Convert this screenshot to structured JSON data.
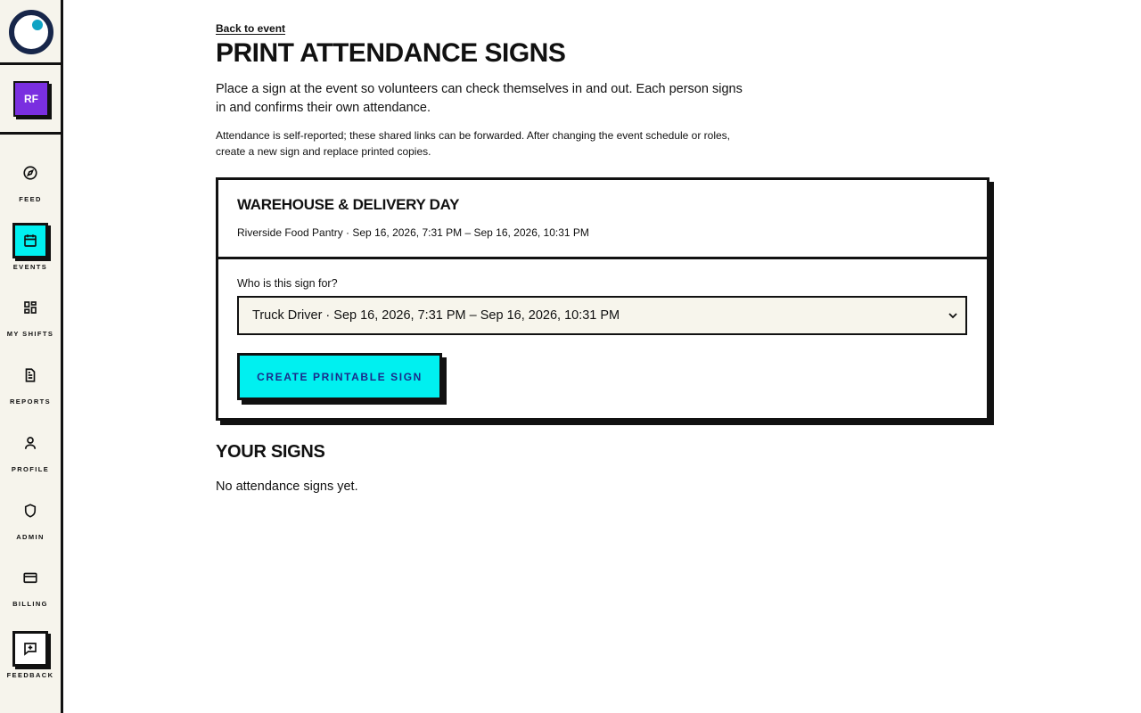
{
  "org": {
    "initials": "RF"
  },
  "nav": [
    {
      "id": "feed",
      "label": "FEED",
      "icon": "compass-icon"
    },
    {
      "id": "events",
      "label": "EVENTS",
      "icon": "calendar-icon",
      "active": true
    },
    {
      "id": "my-shifts",
      "label": "MY SHIFTS",
      "icon": "grid-icon"
    },
    {
      "id": "reports",
      "label": "REPORTS",
      "icon": "document-icon"
    },
    {
      "id": "profile",
      "label": "PROFILE",
      "icon": "user-icon"
    },
    {
      "id": "admin",
      "label": "ADMIN",
      "icon": "shield-icon"
    },
    {
      "id": "billing",
      "label": "BILLING",
      "icon": "credit-card-icon"
    },
    {
      "id": "feedback",
      "label": "FEEDBACK",
      "icon": "message-plus-icon"
    }
  ],
  "page": {
    "back_link": "Back to event",
    "title": "PRINT ATTENDANCE SIGNS",
    "intro": "Place a sign at the event so volunteers can check themselves in and out. Each person signs in and confirms their own attendance.",
    "note": "Attendance is self-reported; these shared links can be forwarded. After changing the event schedule or roles, create a new sign and replace printed copies."
  },
  "event": {
    "name": "WAREHOUSE & DELIVERY DAY",
    "meta": "Riverside Food Pantry · Sep 16, 2026, 7:31 PM – Sep 16, 2026, 10:31 PM"
  },
  "form": {
    "label": "Who is this sign for?",
    "selected": "Truck Driver · Sep 16, 2026, 7:31 PM – Sep 16, 2026, 10:31 PM",
    "button": "CREATE PRINTABLE SIGN"
  },
  "signs": {
    "title": "YOUR SIGNS",
    "empty": "No attendance signs yet."
  },
  "colors": {
    "accent": "#00f0f0",
    "org_badge": "#7a2fe0",
    "logo": "#17264a",
    "sidebar_bg": "#f6f4ec"
  }
}
